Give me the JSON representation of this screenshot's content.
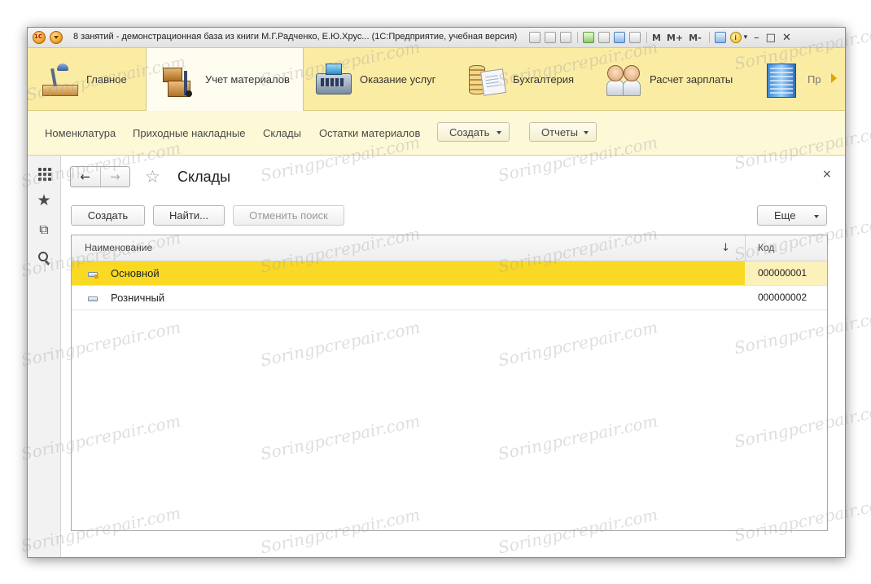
{
  "window": {
    "title": "8 занятий - демонстрационная база из книги М.Г.Радченко, Е.Ю.Хрус... (1С:Предприятие, учебная версия)",
    "titlebar_buttons": [
      "M",
      "M+",
      "M-"
    ],
    "window_controls": [
      "–",
      "□",
      "✕"
    ]
  },
  "sections": [
    {
      "label": "Главное",
      "icon": "desk-lamp-icon"
    },
    {
      "label": "Учет материалов",
      "icon": "boxes-cart-icon",
      "active": true
    },
    {
      "label": "Оказание услуг",
      "icon": "cash-register-icon"
    },
    {
      "label": "Бухгалтерия",
      "icon": "coins-ledger-icon"
    },
    {
      "label": "Расчет зарплаты",
      "icon": "employees-icon"
    },
    {
      "label": "Пр",
      "icon": "building-icon"
    }
  ],
  "function_panel": {
    "links": [
      "Номенклатура",
      "Приходные накладные",
      "Склады",
      "Остатки материалов"
    ],
    "create_label": "Создать",
    "reports_label": "Отчеты"
  },
  "form": {
    "title": "Склады",
    "close": "×",
    "buttons": {
      "create": "Создать",
      "find": "Найти...",
      "cancel_search": "Отменить поиск",
      "more": "Еще"
    },
    "columns": {
      "name": "Наименование",
      "sort_indicator": "↓",
      "code": "Код"
    },
    "rows": [
      {
        "name": "Основной",
        "code": "000000001",
        "selected": true
      },
      {
        "name": "Розничный",
        "code": "000000002",
        "selected": false
      }
    ]
  },
  "watermark": "Soringpcrepair.com",
  "colors": {
    "sections_bg": "#fbeca3",
    "selection": "#fad925",
    "function_bg": "#fdf8d6"
  }
}
